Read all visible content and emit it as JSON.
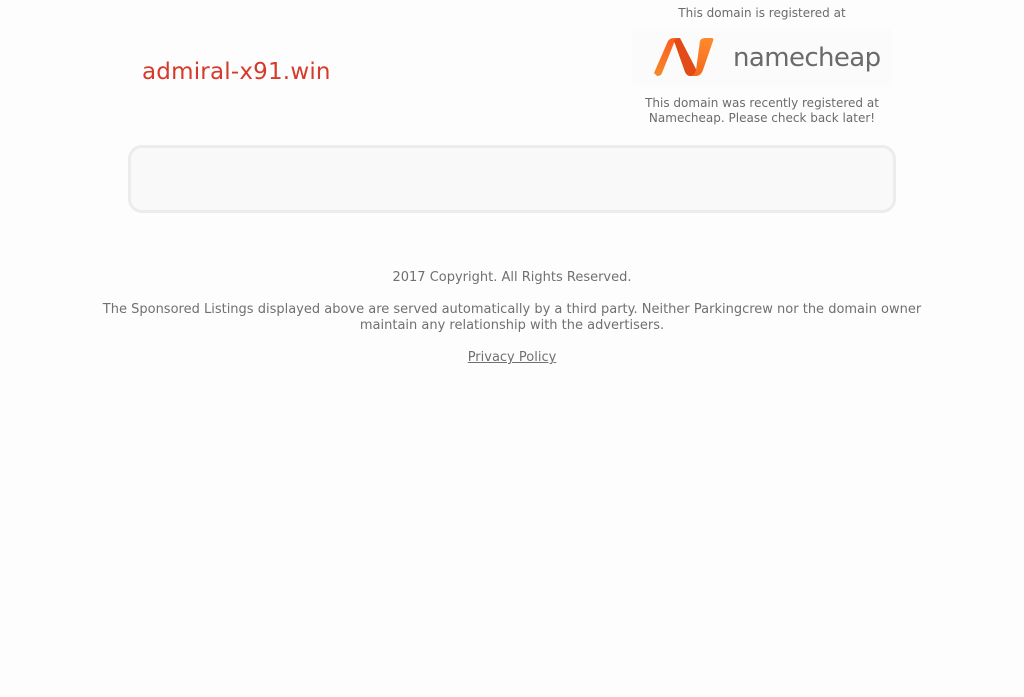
{
  "domain": {
    "name": "admiral-x91.win",
    "color": "#d63a2a"
  },
  "registrar": {
    "caption": "This domain is registered at",
    "logo_text": "namecheap",
    "logo_icon": "namecheap-n-logo-icon",
    "note_line1": "This domain was recently registered at",
    "note_line2": "Namecheap. Please check back later!"
  },
  "listings": {
    "items": []
  },
  "footer": {
    "copyright": "2017 Copyright. All Rights Reserved.",
    "disclaimer": "The Sponsored Listings displayed above are served automatically by a third party. Neither Parkingcrew nor the domain owner maintain any relationship with the advertisers.",
    "privacy_label": "Privacy Policy"
  }
}
